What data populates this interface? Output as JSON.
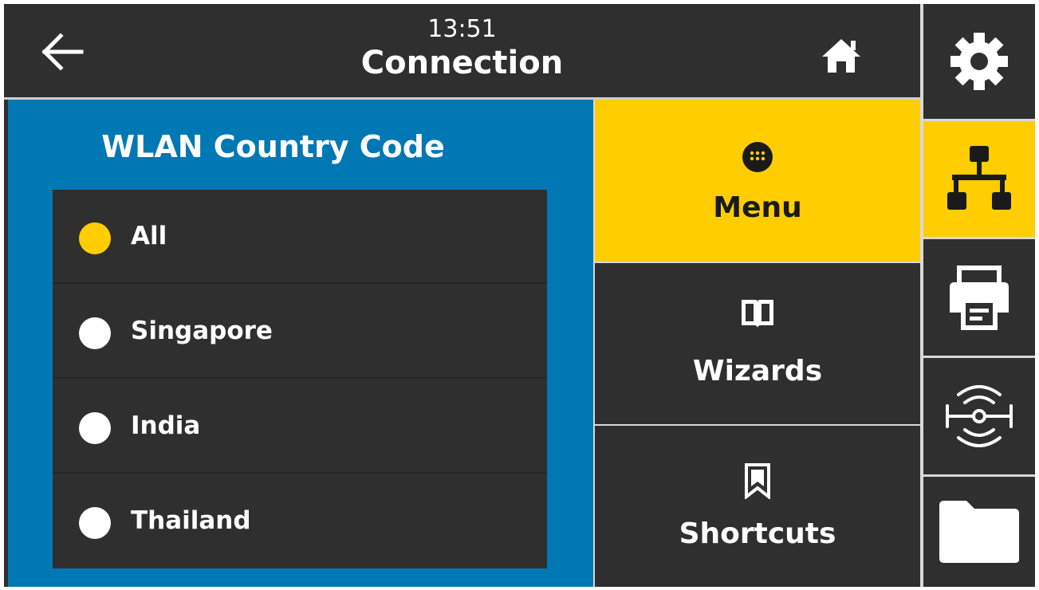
{
  "header": {
    "time": "13:51",
    "title": "Connection",
    "back_icon": "arrow-left-icon",
    "home_icon": "home-icon"
  },
  "panel": {
    "title": "WLAN Country Code",
    "options": [
      {
        "label": "All",
        "selected": true
      },
      {
        "label": "Singapore",
        "selected": false
      },
      {
        "label": "India",
        "selected": false
      },
      {
        "label": "Thailand",
        "selected": false
      }
    ]
  },
  "nav": {
    "menu": {
      "label": "Menu",
      "icon": "apps-grid-icon"
    },
    "wizards": {
      "label": "Wizards",
      "icon": "book-icon"
    },
    "shortcuts": {
      "label": "Shortcuts",
      "icon": "bookmark-icon"
    }
  },
  "sidebar": {
    "tabs": [
      {
        "icon": "gear-icon",
        "active": false
      },
      {
        "icon": "network-icon",
        "active": true
      },
      {
        "icon": "printer-icon",
        "active": false
      },
      {
        "icon": "rfid-icon",
        "active": false
      },
      {
        "icon": "folder-icon",
        "active": false
      }
    ]
  },
  "colors": {
    "accent": "#ffcd00",
    "panel_blue": "#0078b4",
    "dark": "#2f2f2f"
  }
}
